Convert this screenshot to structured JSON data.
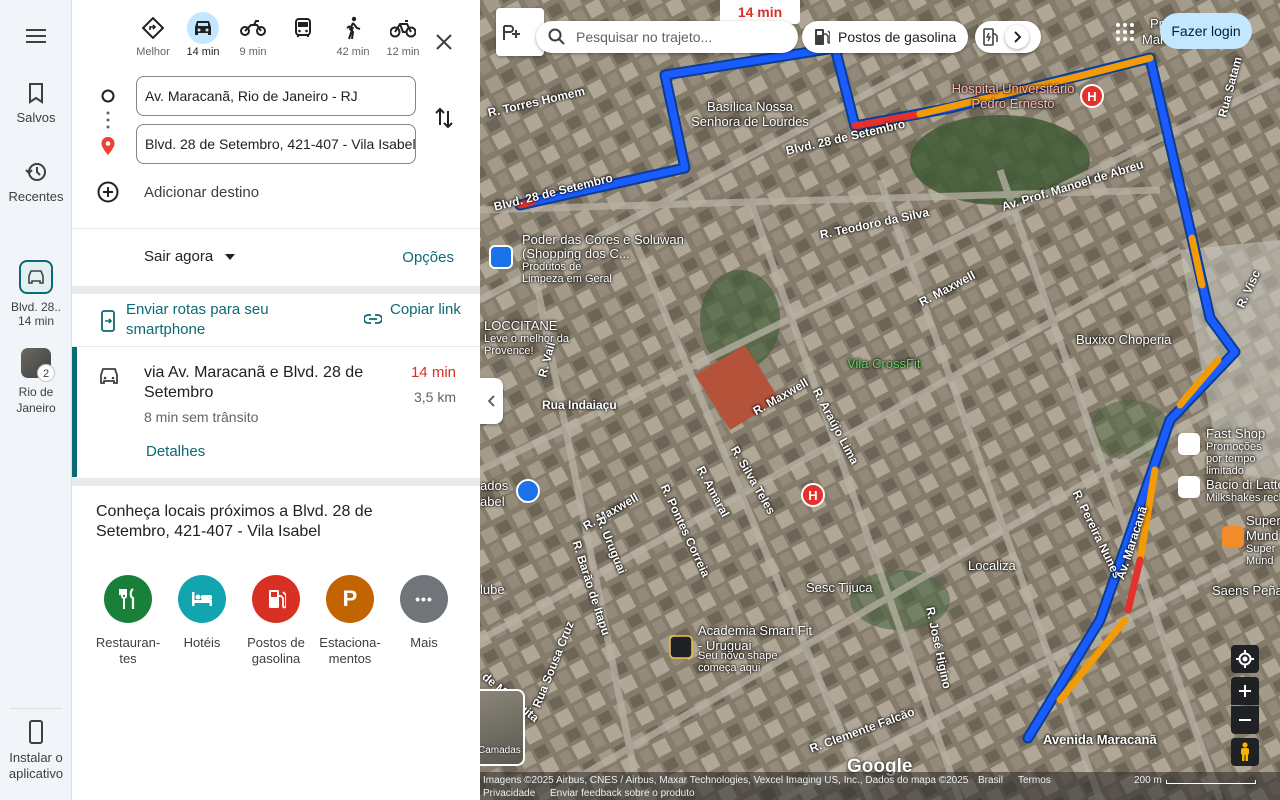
{
  "rail": {
    "menu_icon": "menu-icon",
    "saved_label": "Salvos",
    "recent_label": "Recentes",
    "recent_items": [
      {
        "label": "Blvd. 28..",
        "sub": "14 min"
      },
      {
        "label": "Rio de Janeiro",
        "badge": "2"
      }
    ],
    "install_label": "Instalar o aplicativo"
  },
  "modes": [
    {
      "name": "Melhor",
      "label": "Melhor",
      "icon": "diamond-directions-icon"
    },
    {
      "name": "car",
      "label": "14 min",
      "icon": "car-icon",
      "active": true
    },
    {
      "name": "motorcycle",
      "label": "9 min",
      "icon": "motorcycle-icon"
    },
    {
      "name": "transit",
      "label": "",
      "icon": "bus-icon"
    },
    {
      "name": "walk",
      "label": "42 min",
      "icon": "walk-icon"
    },
    {
      "name": "bike",
      "label": "12 min",
      "icon": "bike-icon"
    }
  ],
  "directions": {
    "origin": "Av. Maracanã, Rio de Janeiro - RJ",
    "destination": "Blvd. 28 de Setembro, 421-407 - Vila Isabel",
    "add_destination": "Adicionar destino"
  },
  "depart": {
    "label": "Sair agora",
    "options": "Opções"
  },
  "send": {
    "send_label": "Enviar rotas para seu smartphone",
    "copy_label": "Copiar link"
  },
  "route": {
    "title": "via Av. Maracanã e Blvd. 28 de Setembro",
    "time": "14 min",
    "distance": "3,5 km",
    "traffic": "8 min sem trânsito",
    "details": "Detalhes"
  },
  "nearby": {
    "title": "Conheça locais próximos a Blvd. 28 de Setembro, 421-407 - Vila Isabel",
    "categories": [
      {
        "label": "Restauran-tes",
        "color": "#188038",
        "icon": "fork-knife-icon"
      },
      {
        "label": "Hotéis",
        "color": "#12a4af",
        "icon": "bed-icon"
      },
      {
        "label": "Postos de gasolina",
        "color": "#d93025",
        "icon": "gas-pump-icon"
      },
      {
        "label": "Estaciona-mentos",
        "color": "#c26401",
        "icon": "parking-icon",
        "glyph": "P"
      },
      {
        "label": "Mais",
        "color": "#70757a",
        "icon": "more-icon",
        "glyph": "•••"
      }
    ]
  },
  "map": {
    "route_time": "14 min",
    "search_placeholder": "Pesquisar no trajeto...",
    "chip_gas": "Postos de gasolina",
    "login": "Fazer login",
    "layers_label": "Camadas",
    "google_logo": "Google",
    "attribution": "Imagens ©2025 Airbus, CNES / Airbus, Maxar Technologies, Vexcel Imaging US, Inc., Dados do mapa ©2025",
    "brasil": "Brasil",
    "termos": "Termos",
    "privacidade": "Privacidade",
    "feedback": "Enviar feedback sobre o produto",
    "scale": "200 m",
    "labels": {
      "basilica": "Basílica Nossa Senhora de Lourdes",
      "hospital": "Hospital Universitário Pedro Ernesto",
      "poder": "Poder das Cores e Soluwan (Shopping dos C...",
      "poder_sub": "Produtos de Limpeza em Geral",
      "loccitane": "LOCCITANE",
      "loccitane_sub": "Leve o melhor da Provence!",
      "crossfit": "Vila CrossFit",
      "buxixo": "Buxixo Choperia",
      "fastshop": "Fast Shop",
      "fastshop_sub": "Promoções por tempo limitado",
      "bacio": "Bacio di Latte",
      "bacio_sub": "Milkshakes rech",
      "super": "Super Mund",
      "super_sub": "Super Mund",
      "saens": "Saens Peña",
      "localiza": "Localiza",
      "sesc": "Sesc Tijuca",
      "academia": "Academia Smart Fit - Uruguai",
      "academia_sub": "Seu novo shape começa aqui",
      "avenida": "Avenida Maracanã",
      "ados": "ados",
      "abel": "abel",
      "lube": "lube",
      "pra": "Pra",
      "mara": "Mara"
    },
    "streets": {
      "torres": "R. Torres Homem",
      "blvd1": "Blvd. 28 de Setembro",
      "blvd2": "Blvd. 28 de Setembro",
      "teodoro": "R. Teodoro da Silva",
      "manoel": "Av. Prof. Manoel de Abreu",
      "maxwell1": "R. Maxwell",
      "maxwell2": "R. Maxwell",
      "maxwell3": "R. Maxwell",
      "araujo": "R. Araújo Lima",
      "indaiacu": "Rua Indaiaçu",
      "vail": "R. Vail",
      "silva": "R. Silva Teles",
      "amaral": "R. Amaral",
      "pontes": "R. Pontes Correia",
      "uruguai": "R. Uruguai",
      "barao": "R. Barão de Itapu",
      "pereira": "R. Pereira Nunes",
      "maracana": "Av. Maracanã",
      "jose": "R. José Higino",
      "clemente": "R. Clemente Falcão",
      "mesquita": "de Mesquita",
      "sousa": "Rua Sousa Cruz",
      "satam": "Rua Satam",
      "visc": "R. Visc"
    }
  }
}
